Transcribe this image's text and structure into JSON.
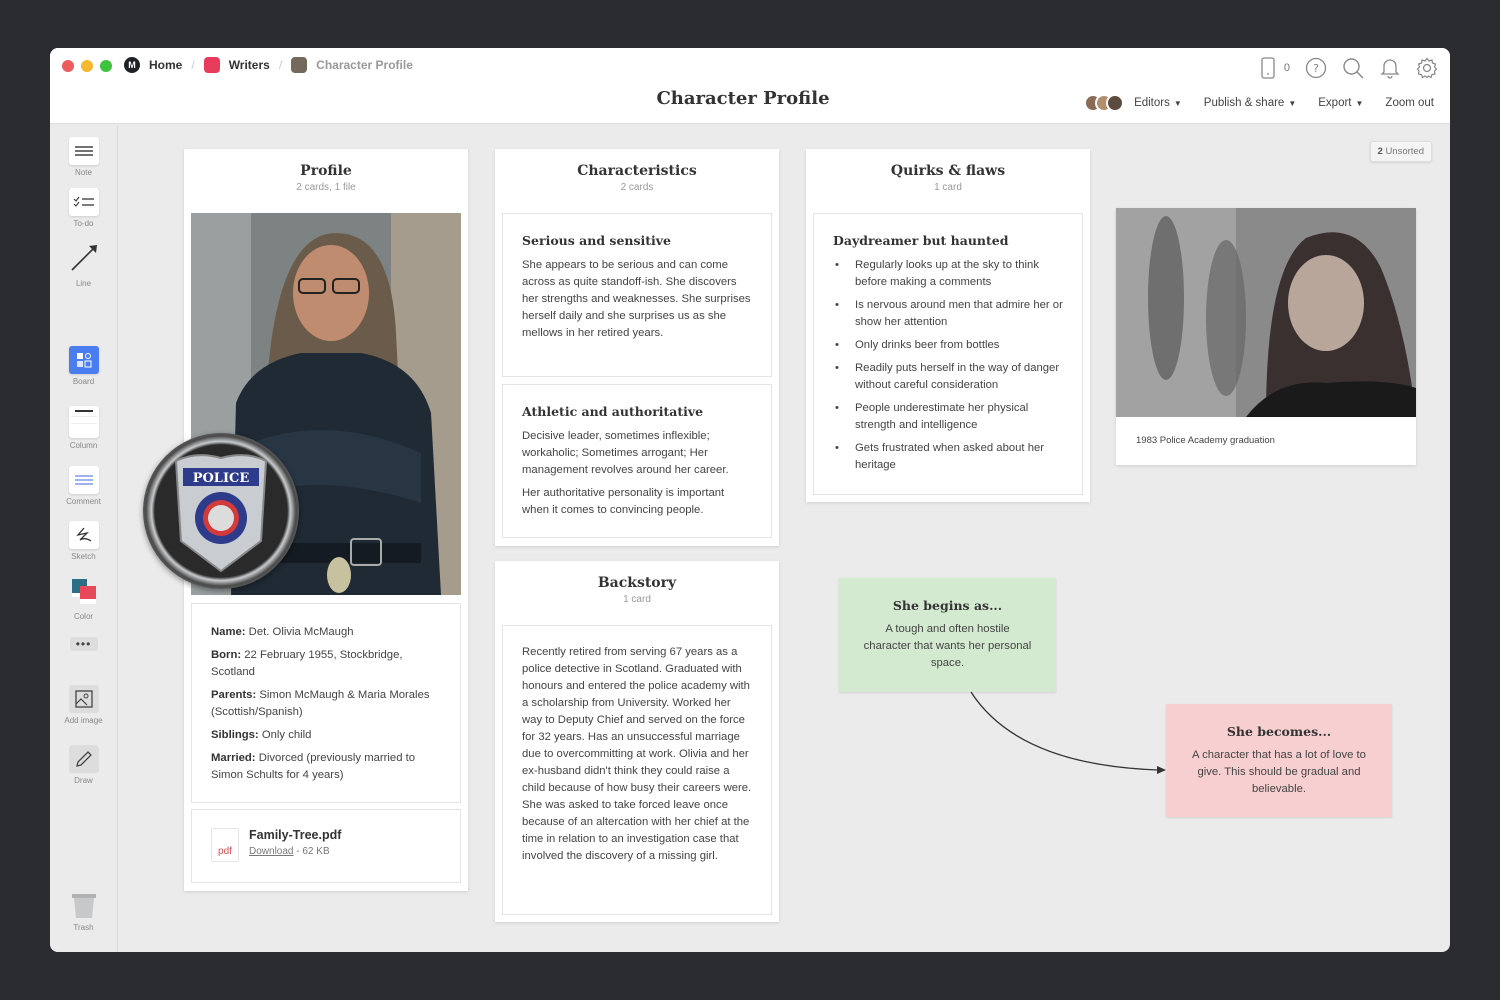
{
  "window": {
    "traffic_colors": [
      "#ec5b5d",
      "#f5b82e",
      "#3ec33f"
    ],
    "breadcrumbs": [
      {
        "label": "Home",
        "icon": "milanote-logo-icon",
        "color": "#1f2128"
      },
      {
        "label": "Writers",
        "icon": "board-icon",
        "color": "#e83a5a"
      },
      {
        "label": "Character Profile",
        "icon": "board-icon",
        "color": "#736a5b"
      }
    ],
    "title": "Character Profile"
  },
  "top_icons": {
    "device_count": "0",
    "icons": [
      "mobile-device-icon",
      "help-icon",
      "search-icon",
      "bell-icon",
      "gear-icon"
    ]
  },
  "actions": {
    "editors": "Editors",
    "publish": "Publish & share",
    "export": "Export",
    "zoom_out": "Zoom out"
  },
  "sidebar": {
    "tools": [
      {
        "label": "Note",
        "icon": "note-icon"
      },
      {
        "label": "To-do",
        "icon": "todo-icon"
      },
      {
        "label": "Line",
        "icon": "line-arrow-icon"
      },
      {
        "label": "Board",
        "icon": "board-icon"
      },
      {
        "label": "Column",
        "icon": "column-icon"
      },
      {
        "label": "Comment",
        "icon": "comment-icon"
      },
      {
        "label": "Sketch",
        "icon": "sketch-icon"
      },
      {
        "label": "Color",
        "icon": "color-swatch-icon"
      },
      {
        "label": "",
        "icon": "more-icon"
      },
      {
        "label": "Add image",
        "icon": "image-icon"
      },
      {
        "label": "Draw",
        "icon": "pen-icon"
      },
      {
        "label": "Trash",
        "icon": "trash-icon"
      }
    ]
  },
  "unsorted": {
    "count": "2",
    "label": "Unsorted"
  },
  "columns": {
    "profile": {
      "title": "Profile",
      "subtitle": "2 cards, 1 file",
      "badge_text": "POLICE",
      "fields": [
        {
          "label": "Name:",
          "value": "Det. Olivia McMaugh"
        },
        {
          "label": "Born:",
          "value": "22 February 1955, Stockbridge, Scotland"
        },
        {
          "label": "Parents:",
          "value": "Simon McMaugh & Maria Morales (Scottish/Spanish)"
        },
        {
          "label": "Siblings:",
          "value": "Only child"
        },
        {
          "label": "Married:",
          "value": "Divorced (previously married to Simon Schults for 4 years)"
        }
      ],
      "file": {
        "name": "Family-Tree.pdf",
        "type": "pdf",
        "download": "Download",
        "size": "- 62 KB"
      }
    },
    "characteristics": {
      "title": "Characteristics",
      "subtitle": "2 cards",
      "cards": [
        {
          "title": "Serious and sensitive",
          "paragraphs": [
            "She appears to be serious and can come across as quite standoff-ish. She discovers her strengths and weaknesses. She surprises herself daily and she surprises us as she mellows in her retired years."
          ]
        },
        {
          "title": "Athletic and authoritative",
          "paragraphs": [
            "Decisive leader, sometimes inflexible; workaholic; Sometimes arrogant; Her management revolves around her career.",
            "Her authoritative personality is important when it comes to convincing people."
          ]
        }
      ]
    },
    "backstory": {
      "title": "Backstory",
      "subtitle": "1 card",
      "text": "Recently retired from serving 67 years as a police detective in Scotland. Graduated with honours and entered the police academy with a scholarship from University. Worked her way to Deputy Chief and served on the force for 32 years. Has an unsuccessful marriage due to overcommitting at work. Olivia and her ex-husband didn't think they could raise a child because of how busy their careers were. She was asked to take forced leave once because of an altercation with her chief at the time in relation to an investigation case that involved the discovery of a missing girl."
    },
    "quirks": {
      "title": "Quirks & flaws",
      "subtitle": "1 card",
      "card_title": "Daydreamer but haunted",
      "bullets": [
        "Regularly looks up at the sky to think before making a comments",
        "Is nervous around men that admire her or show her attention",
        "Only drinks beer from bottles",
        "Readily puts herself in the way of danger without careful consideration",
        "People underestimate her physical strength and intelligence",
        "Gets frustrated when asked about her heritage"
      ]
    }
  },
  "image_card": {
    "caption": "1983 Police Academy graduation"
  },
  "stickies": {
    "begins": {
      "title": "She begins as...",
      "text": "A tough and often hostile character that wants her personal space.",
      "color": "#d3ead0"
    },
    "becomes": {
      "title": "She becomes...",
      "text": "A character that has a lot of love to give. This should be gradual and believable.",
      "color": "#f8cfd0"
    }
  }
}
